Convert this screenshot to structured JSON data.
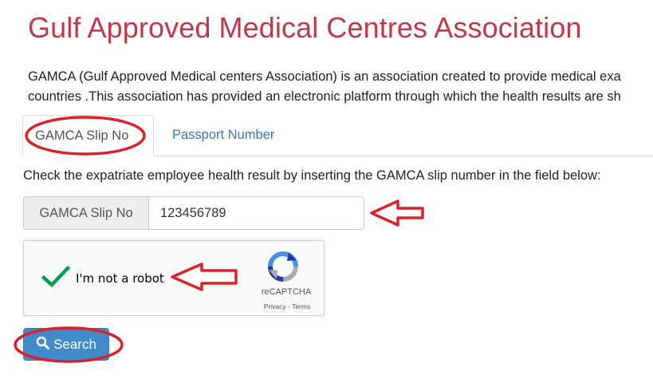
{
  "page": {
    "title": "Gulf Approved Medical Centres Association",
    "intro_line1": "GAMCA (Gulf Approved Medical centers Association) is an association created to provide medical exa",
    "intro_line2": "countries .This association has provided an electronic platform through which the health results are sh"
  },
  "tabs": [
    {
      "label": "GAMCA Slip No",
      "active": true
    },
    {
      "label": "Passport Number",
      "active": false
    }
  ],
  "form": {
    "instruction": "Check the expatriate employee health result by inserting the GAMCA slip number in the field below:",
    "addon_label": "GAMCA Slip No",
    "slip_value": "123456789"
  },
  "captcha": {
    "label": "I'm not a robot",
    "brand": "reCAPTCHA",
    "links": "Privacy - Terms",
    "checked": true
  },
  "search_button": {
    "label": "Search"
  },
  "colors": {
    "title": "#c0394b",
    "link": "#337ab7",
    "primary": "#428bca",
    "annotation": "#d9222a",
    "check": "#009e55"
  },
  "icons": {
    "search": "magnifier-icon",
    "check": "check-icon",
    "recaptcha": "recaptcha-logo-icon",
    "annotation_arrow": "left-arrow-outline-icon"
  }
}
